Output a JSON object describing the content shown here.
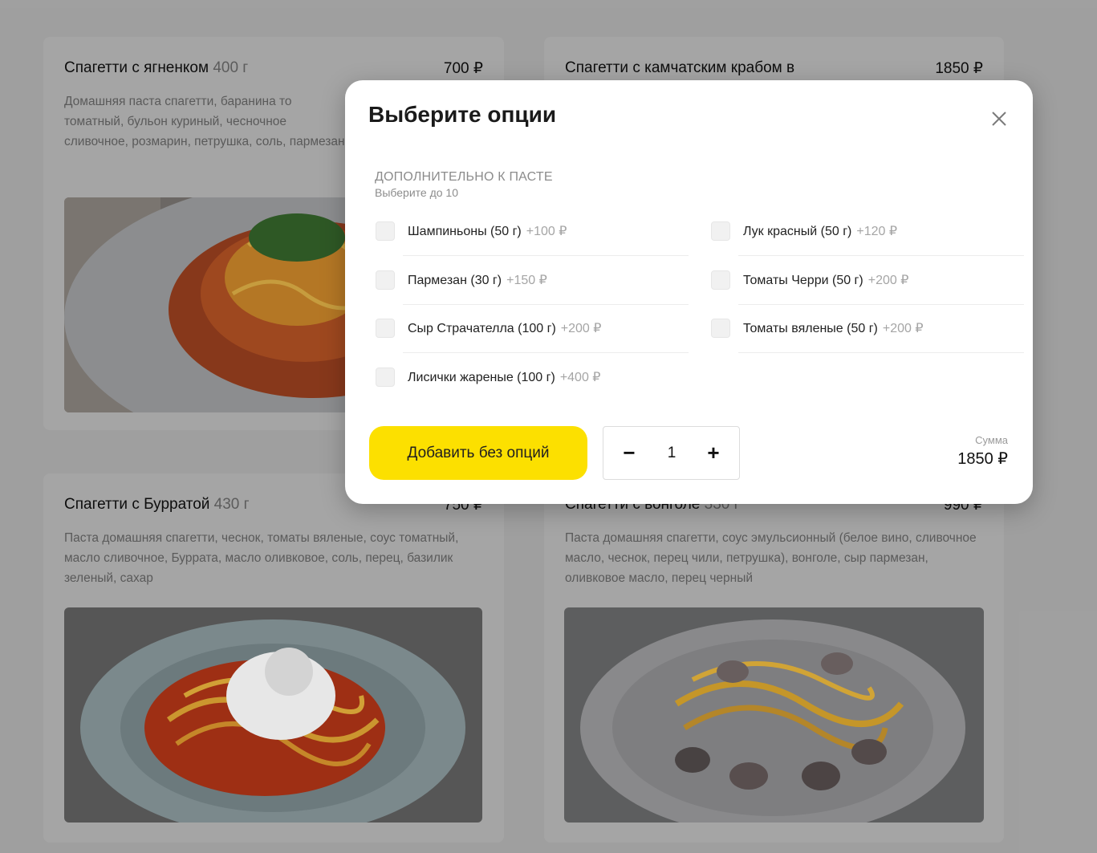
{
  "cards": [
    {
      "title": "Спагетти с ягненком",
      "weight": "400 г",
      "price": "700 ₽",
      "desc": "Домашняя паста спагетти, баранина то томатный, бульон куриный, чесночное сливочное, розмарин, петрушка, соль, пармезан"
    },
    {
      "title": "Спагетти с камчатским крабом в",
      "weight": "",
      "price": "1850 ₽",
      "desc": ""
    },
    {
      "title": "Спагетти с Бурратой",
      "weight": "430 г",
      "price": "750 ₽",
      "desc": "Паста домашняя спагетти, чеснок, томаты вяленые, соус томатный, масло сливочное, Буррата, масло оливковое, соль, перец, базилик зеленый, сахар"
    },
    {
      "title": "Спагетти с вонголе",
      "weight": "330 г",
      "price": "990 ₽",
      "desc": "Паста домашняя спагетти, соус эмульсионный (белое вино, сливочное масло, чеснок, перец чили, петрушка), вонголе, сыр пармезан, оливковое масло, перец черный"
    }
  ],
  "modal": {
    "title": "Выберите опции",
    "section_title": "ДОПОЛНИТЕЛЬНО К ПАСТЕ",
    "section_sub": "Выберите до 10",
    "options": [
      {
        "label": "Шампиньоны (50 г)",
        "add": "+100 ₽",
        "checked": false
      },
      {
        "label": "Лук красный (50 г)",
        "add": "+120 ₽",
        "checked": false
      },
      {
        "label": "Пармезан (30 г)",
        "add": "+150 ₽",
        "checked": false
      },
      {
        "label": "Томаты Черри (50 г)",
        "add": "+200 ₽",
        "checked": false
      },
      {
        "label": "Сыр Страчателла (100 г)",
        "add": "+200 ₽",
        "checked": false
      },
      {
        "label": "Томаты вяленые (50 г)",
        "add": "+200 ₽",
        "checked": false
      },
      {
        "label": "Лисички жареные (100 г)",
        "add": "+400 ₽",
        "checked": false
      }
    ],
    "add_button": "Добавить без опций",
    "minus": "−",
    "quantity": "1",
    "plus": "+",
    "sum_label": "Сумма",
    "sum_value": "1850 ₽",
    "close_icon": "close-icon"
  },
  "colors": {
    "accent_yellow": "#fce000",
    "backdrop": "#a3a3a3"
  }
}
